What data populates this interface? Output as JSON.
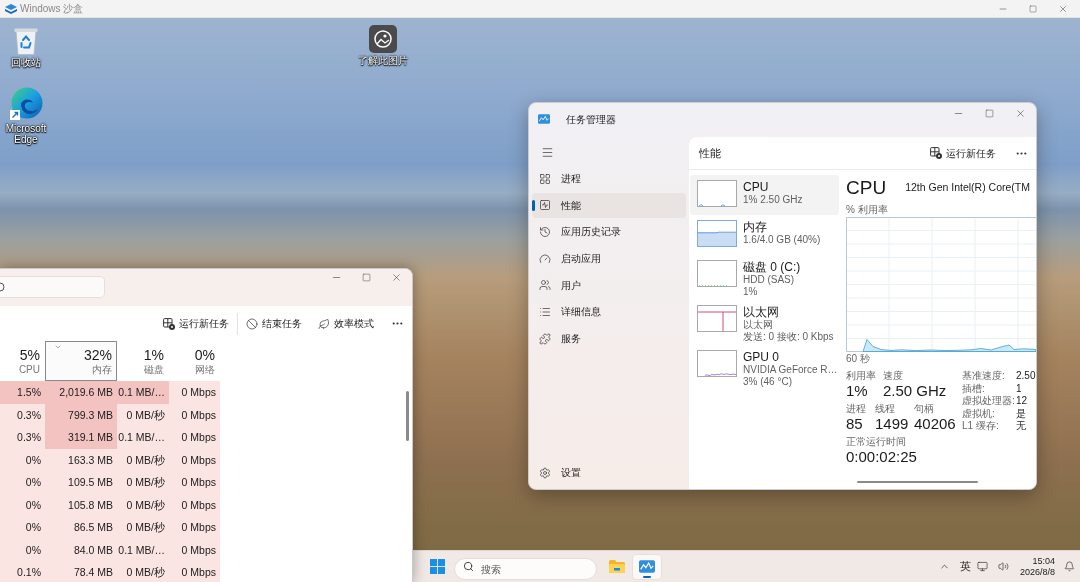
{
  "sandbox": {
    "title": "Windows 沙盒"
  },
  "desktop_icons": [
    {
      "kind": "recycle-bin",
      "label": "回收站"
    },
    {
      "kind": "browser",
      "label": "Microsoft Edge"
    },
    {
      "kind": "picture",
      "label": "了解此图片"
    }
  ],
  "task_manager": {
    "title": "任务管理器",
    "nav": [
      {
        "kind": "processes",
        "label": "进程",
        "selected": false
      },
      {
        "kind": "performance",
        "label": "性能",
        "selected": true
      },
      {
        "kind": "history",
        "label": "应用历史记录",
        "selected": false
      },
      {
        "kind": "startup",
        "label": "启动应用",
        "selected": false
      },
      {
        "kind": "users",
        "label": "用户",
        "selected": false
      },
      {
        "kind": "details",
        "label": "详细信息",
        "selected": false
      },
      {
        "kind": "services",
        "label": "服务",
        "selected": false
      }
    ],
    "settings": "设置",
    "page_title": "性能",
    "run_task": "运行新任务",
    "devices": [
      {
        "kind": "cpu",
        "name": "CPU",
        "lines": [
          "1% 2.50 GHz"
        ],
        "selected": true
      },
      {
        "kind": "memory",
        "name": "内存",
        "lines": [
          "1.6/4.0 GB (40%)"
        ],
        "selected": false
      },
      {
        "kind": "disk",
        "name": "磁盘 0 (C:)",
        "lines": [
          "HDD (SAS)",
          "1%"
        ],
        "selected": false
      },
      {
        "kind": "ethernet",
        "name": "以太网",
        "lines": [
          "以太网",
          "发送: 0 接收: 0 Kbps"
        ],
        "selected": false
      },
      {
        "kind": "gpu",
        "name": "GPU 0",
        "lines": [
          "NVIDIA GeForce R…",
          "3% (46 °C)"
        ],
        "selected": false
      }
    ],
    "detail": {
      "title": "CPU",
      "model": "12th Gen Intel(R) Core(TM",
      "graph_label": "% 利用率",
      "time_span": "60 秒",
      "stats": [
        [
          {
            "label": "利用率",
            "value": "1%"
          },
          {
            "label": "速度",
            "value": "2.50 GHz"
          }
        ],
        [
          {
            "label": "进程",
            "value": "85"
          },
          {
            "label": "线程",
            "value": "1499"
          },
          {
            "label": "句柄",
            "value": "40206"
          }
        ],
        [
          {
            "label": "正常运行时间",
            "value": "0:00:02:25"
          }
        ]
      ],
      "specs": [
        {
          "label": "基准速度:",
          "value": "2.50"
        },
        {
          "label": "插槽:",
          "value": "1"
        },
        {
          "label": "虚拟处理器:",
          "value": "12"
        },
        {
          "label": "虚拟机:",
          "value": "是"
        },
        {
          "label": "L1 缓存:",
          "value": "无"
        }
      ]
    }
  },
  "process_window": {
    "toolbar": [
      {
        "kind": "run",
        "label": "运行新任务"
      },
      {
        "kind": "end",
        "label": "结束任务"
      },
      {
        "kind": "efficiency",
        "label": "效率模式"
      }
    ],
    "columns": [
      {
        "value": "5%",
        "label": "CPU",
        "selected": false
      },
      {
        "value": "32%",
        "label": "内存",
        "selected": true
      },
      {
        "value": "1%",
        "label": "磁盘",
        "selected": false
      },
      {
        "value": "0%",
        "label": "网络",
        "selected": false
      }
    ],
    "rows": [
      {
        "cells": [
          {
            "text": "1.5%",
            "highlighted": true
          },
          {
            "text": "2,019.6 MB",
            "highlighted": true
          },
          {
            "text": "0.1 MB/…",
            "highlighted": true
          },
          {
            "text": "0 Mbps",
            "highlighted": false
          }
        ]
      },
      {
        "cells": [
          {
            "text": "0.3%",
            "highlighted": false
          },
          {
            "text": "799.3 MB",
            "highlighted": true
          },
          {
            "text": "0 MB/秒",
            "highlighted": false
          },
          {
            "text": "0 Mbps",
            "highlighted": false
          }
        ]
      },
      {
        "cells": [
          {
            "text": "0.3%",
            "highlighted": false
          },
          {
            "text": "319.1 MB",
            "highlighted": true
          },
          {
            "text": "0.1 MB/…",
            "highlighted": false
          },
          {
            "text": "0 Mbps",
            "highlighted": false
          }
        ]
      },
      {
        "cells": [
          {
            "text": "0%",
            "highlighted": false
          },
          {
            "text": "163.3 MB",
            "highlighted": false
          },
          {
            "text": "0 MB/秒",
            "highlighted": false
          },
          {
            "text": "0 Mbps",
            "highlighted": false
          }
        ]
      },
      {
        "cells": [
          {
            "text": "0%",
            "highlighted": false
          },
          {
            "text": "109.5 MB",
            "highlighted": false
          },
          {
            "text": "0 MB/秒",
            "highlighted": false
          },
          {
            "text": "0 Mbps",
            "highlighted": false
          }
        ]
      },
      {
        "cells": [
          {
            "text": "0%",
            "highlighted": false
          },
          {
            "text": "105.8 MB",
            "highlighted": false
          },
          {
            "text": "0 MB/秒",
            "highlighted": false
          },
          {
            "text": "0 Mbps",
            "highlighted": false
          }
        ]
      },
      {
        "cells": [
          {
            "text": "0%",
            "highlighted": false
          },
          {
            "text": "86.5 MB",
            "highlighted": false
          },
          {
            "text": "0 MB/秒",
            "highlighted": false
          },
          {
            "text": "0 Mbps",
            "highlighted": false
          }
        ]
      },
      {
        "cells": [
          {
            "text": "0%",
            "highlighted": false
          },
          {
            "text": "84.0 MB",
            "highlighted": false
          },
          {
            "text": "0.1 MB/…",
            "highlighted": false
          },
          {
            "text": "0 Mbps",
            "highlighted": false
          }
        ]
      },
      {
        "cells": [
          {
            "text": "0.1%",
            "highlighted": false
          },
          {
            "text": "78.4 MB",
            "highlighted": false
          },
          {
            "text": "0 MB/秒",
            "highlighted": false
          },
          {
            "text": "0 Mbps",
            "highlighted": false
          }
        ]
      }
    ]
  },
  "taskbar": {
    "search": {
      "placeholder": "搜索"
    },
    "apps": [
      {
        "kind": "explorer",
        "active": false
      },
      {
        "kind": "task-manager",
        "active": true
      }
    ],
    "input_method": "英",
    "time": "15:04",
    "date": "2026/8/8"
  }
}
